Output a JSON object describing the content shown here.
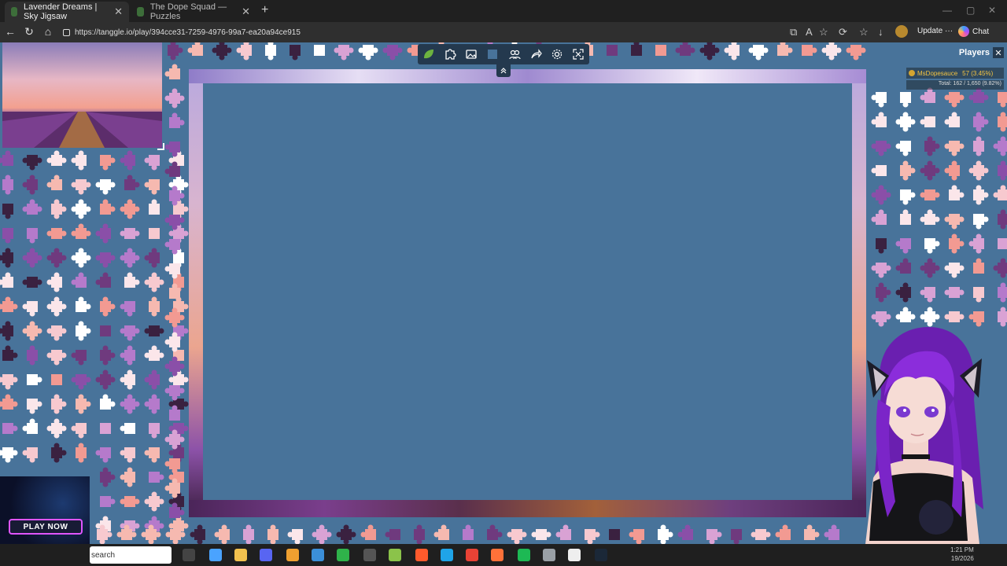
{
  "browser": {
    "tabs": [
      {
        "title": "Lavender Dreams | Sky Jigsaw",
        "active": true
      },
      {
        "title": "The Dope Squad — Puzzles",
        "active": false
      }
    ],
    "url": "https://tanggle.io/play/394cce31-7259-4976-99a7-ea20a94ce915",
    "update_label": "Update",
    "update_more": "···",
    "chat_label": "Chat"
  },
  "game": {
    "players_title": "Players",
    "player": {
      "name": "MsDopesauce",
      "score": "57 (3.45%)"
    },
    "total": "Total: 162 / 1,650 (9.82%)",
    "toolbar_icons": [
      "leaf-icon",
      "puzzle-piece-icon",
      "image-icon",
      "square-icon",
      "people-icon",
      "share-icon",
      "gear-icon",
      "fullscreen-icon"
    ]
  },
  "ad": {
    "cta": "PLAY NOW"
  },
  "taskbar": {
    "search_label": "search",
    "time": "1:21 PM",
    "date": "19/2026"
  },
  "colors": {
    "board_bg": "#48739a",
    "toolbar_bg": "#24394e",
    "player_name": "#f2c341"
  }
}
